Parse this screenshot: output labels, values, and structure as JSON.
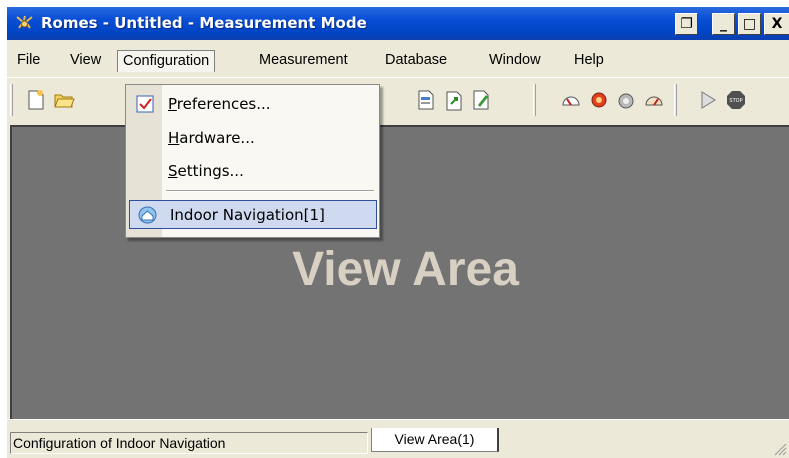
{
  "window": {
    "title": "Romes - Untitled - Measurement Mode",
    "controls": {
      "restore": "❐",
      "minimize": "_",
      "maximize": "□",
      "close": "X"
    }
  },
  "menubar": {
    "items": [
      "File",
      "View",
      "Configuration",
      "Measurement",
      "Database",
      "Window",
      "Help"
    ],
    "active": "Configuration"
  },
  "dropdown": {
    "items": [
      {
        "accel": "P",
        "rest": "references...",
        "icon": "checkbox-icon"
      },
      {
        "accel": "H",
        "rest": "ardware...",
        "icon": ""
      },
      {
        "accel": "S",
        "rest": "ettings...",
        "icon": ""
      }
    ],
    "highlighted": {
      "label": "Indoor Navigation[1]",
      "icon": "indoor-navigation-icon"
    }
  },
  "view": {
    "label": "View Area"
  },
  "statusbar": {
    "text": "Configuration of Indoor Navigation",
    "tab": "View Area(1)"
  },
  "colors": {
    "titlebar": "#0046c8",
    "view_background": "#737373",
    "view_label": "#d8d0c3",
    "highlight": "#cfd9ef"
  }
}
